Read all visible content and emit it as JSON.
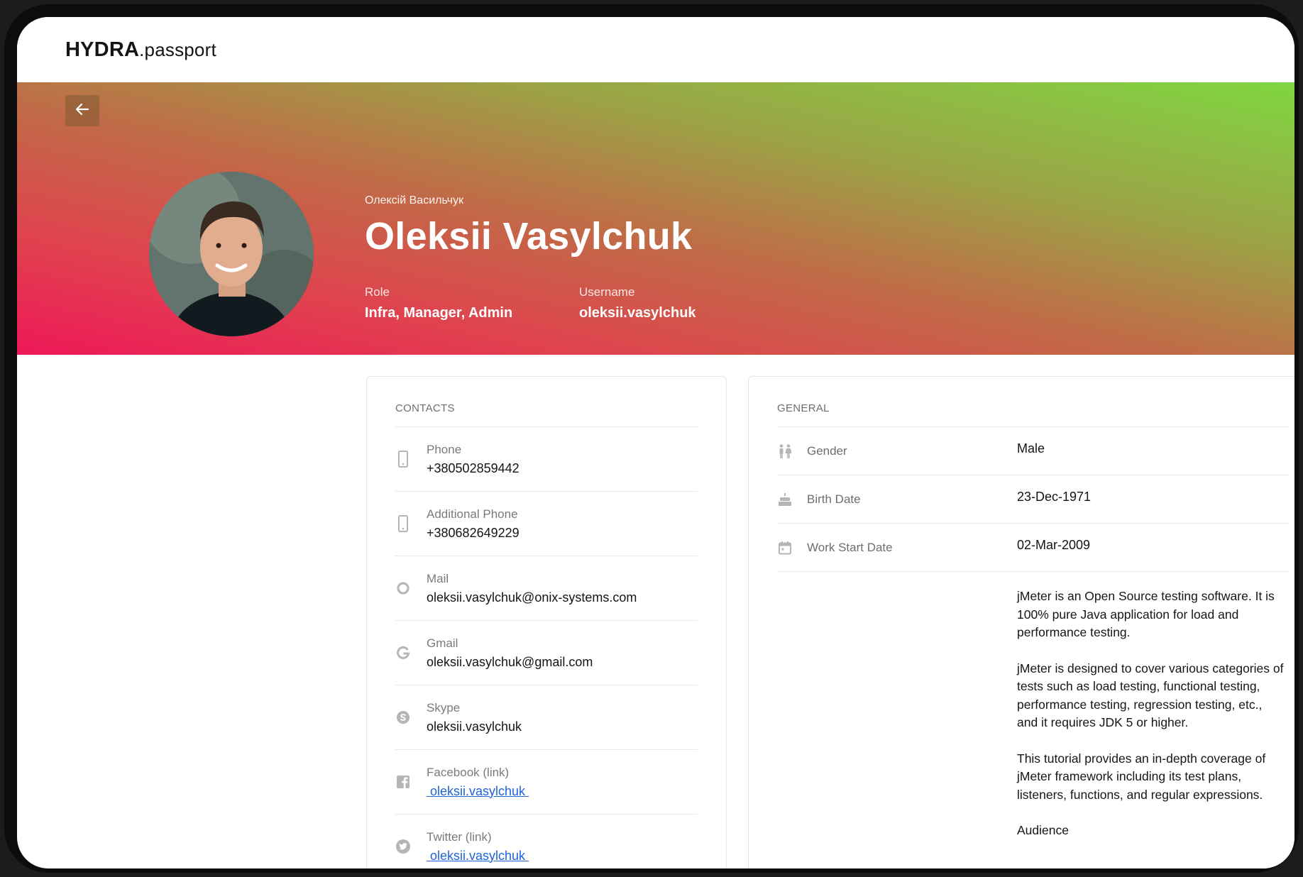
{
  "app": {
    "logo_bold": "HYDRA",
    "logo_light": ".passport"
  },
  "hero": {
    "native_name": "Олексій Васильчук",
    "full_name": "Oleksii Vasylchuk",
    "role_label": "Role",
    "role_value": "Infra, Manager, Admin",
    "username_label": "Username",
    "username_value": "oleksii.vasylchuk"
  },
  "contacts": {
    "title": "CONTACTS",
    "items": [
      {
        "label": "Phone",
        "value": "+380502859442",
        "icon": "phone-icon"
      },
      {
        "label": "Additional Phone",
        "value": "+380682649229",
        "icon": "phone-icon"
      },
      {
        "label": "Mail",
        "value": "oleksii.vasylchuk@onix-systems.com",
        "icon": "mail-icon"
      },
      {
        "label": "Gmail",
        "value": "oleksii.vasylchuk@gmail.com",
        "icon": "google-icon"
      },
      {
        "label": "Skype",
        "value": "oleksii.vasylchuk",
        "icon": "skype-icon"
      },
      {
        "label": "Facebook (link)",
        "value": " oleksii.vasylchuk ",
        "icon": "facebook-icon"
      },
      {
        "label": "Twitter (link)",
        "value": " oleksii.vasylchuk ",
        "icon": "twitter-icon"
      }
    ]
  },
  "general": {
    "title": "GENERAL",
    "items": [
      {
        "label": "Gender",
        "value": "Male",
        "icon": "gender-icon"
      },
      {
        "label": "Birth Date",
        "value": "23-Dec-1971",
        "icon": "cake-icon"
      },
      {
        "label": "Work Start Date",
        "value": "02-Mar-2009",
        "icon": "calendar-icon"
      }
    ],
    "description": [
      "jMeter is an Open Source testing software. It is 100% pure Java application for load and performance testing.",
      "jMeter is designed to cover various categories of tests such as load testing, functional testing, performance testing, regression testing, etc., and it requires JDK 5 or higher.",
      "This tutorial provides an in-depth coverage of jMeter framework including its test plans, listeners, functions, and regular expressions.",
      "Audience"
    ]
  },
  "colors": {
    "link": "#1e63d6",
    "hero_start": "#ee1858",
    "hero_end": "#80d640"
  }
}
